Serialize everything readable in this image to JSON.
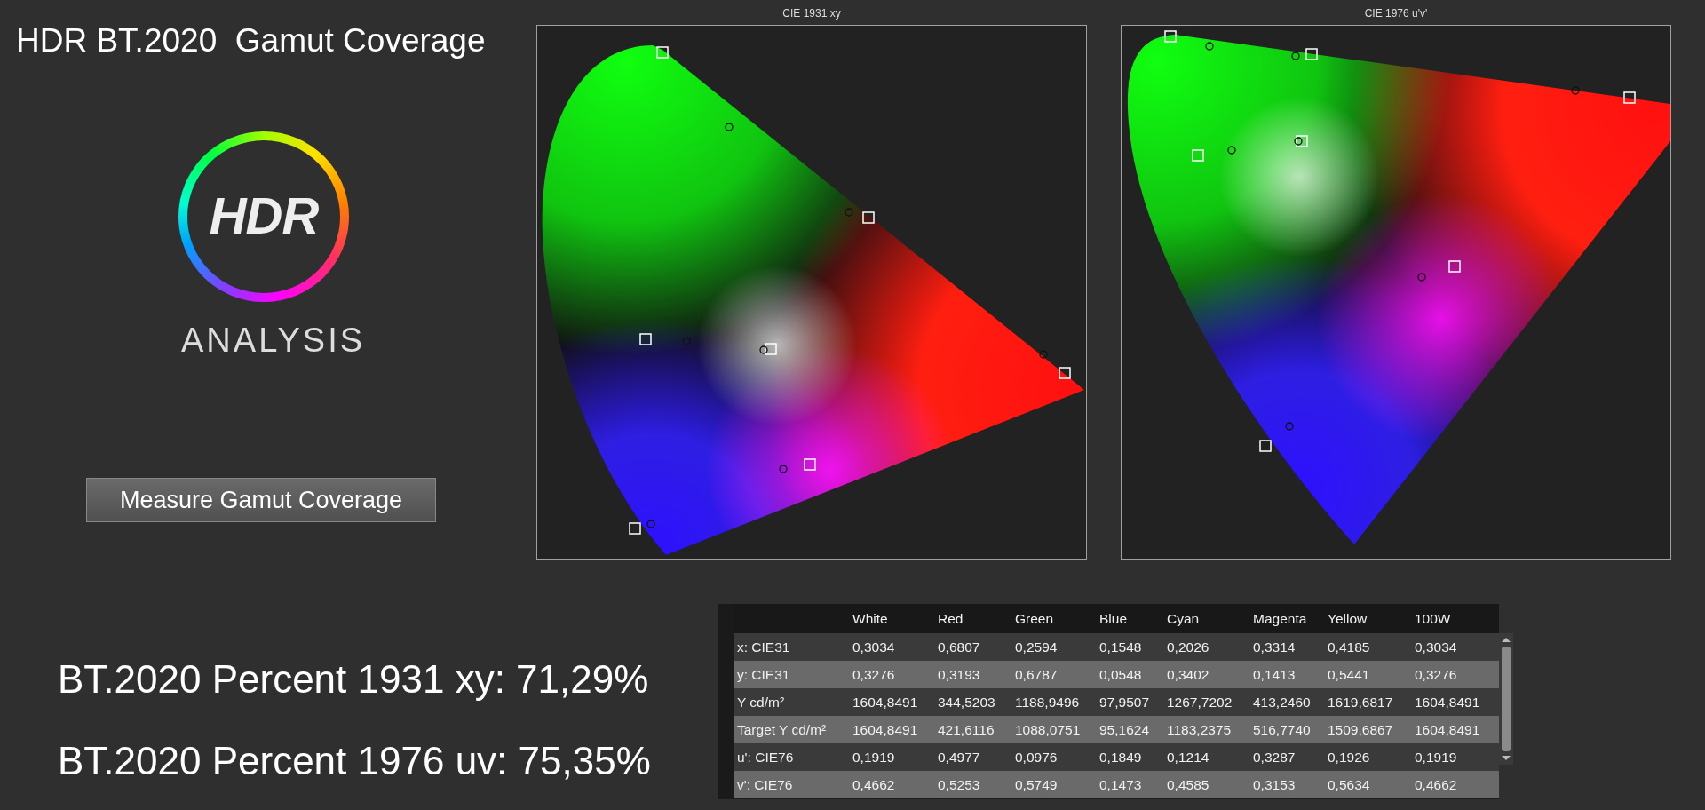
{
  "title": "HDR BT.2020  Gamut Coverage",
  "logo": {
    "mark": "HDR",
    "caption": "ANALYSIS"
  },
  "measure_button": "Measure Gamut Coverage",
  "charts": [
    {
      "kind": "cie1931",
      "title": "CIE 1931 xy"
    },
    {
      "kind": "cie1976",
      "title": "CIE 1976 u'v'"
    }
  ],
  "results": [
    "BT.2020 Percent 1931 xy: 71,29%",
    "BT.2020 Percent 1976 uv: 75,35%"
  ],
  "table": {
    "columns": [
      "White",
      "Red",
      "Green",
      "Blue",
      "Cyan",
      "Magenta",
      "Yellow",
      "100W"
    ],
    "rows": [
      {
        "label": "x: CIE31",
        "cells": [
          "0,3034",
          "0,6807",
          "0,2594",
          "0,1548",
          "0,2026",
          "0,3314",
          "0,4185",
          "0,3034"
        ]
      },
      {
        "label": "y: CIE31",
        "cells": [
          "0,3276",
          "0,3193",
          "0,6787",
          "0,0548",
          "0,3402",
          "0,1413",
          "0,5441",
          "0,3276"
        ]
      },
      {
        "label": "Y cd/m²",
        "cells": [
          "1604,8491",
          "344,5203",
          "1188,9496",
          "97,9507",
          "1267,7202",
          "413,2460",
          "1619,6817",
          "1604,8491"
        ]
      },
      {
        "label": "Target Y cd/m²",
        "cells": [
          "1604,8491",
          "421,6116",
          "1088,0751",
          "95,1624",
          "1183,2375",
          "516,7740",
          "1509,6867",
          "1604,8491"
        ]
      },
      {
        "label": "u': CIE76",
        "cells": [
          "0,1919",
          "0,4977",
          "0,0976",
          "0,1849",
          "0,1214",
          "0,3287",
          "0,1926",
          "0,1919"
        ]
      },
      {
        "label": "v': CIE76",
        "cells": [
          "0,4662",
          "0,5253",
          "0,5749",
          "0,1473",
          "0,4585",
          "0,3153",
          "0,5634",
          "0,4662"
        ]
      }
    ]
  }
}
